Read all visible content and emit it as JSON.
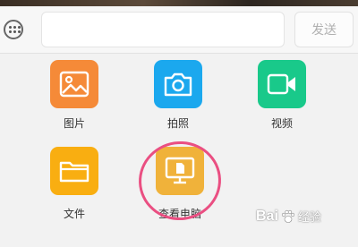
{
  "composer": {
    "input_value": "",
    "send_label": "发送"
  },
  "attachments": [
    {
      "label": "图片",
      "icon": "image-icon",
      "color": "#f58a38"
    },
    {
      "label": "拍照",
      "icon": "camera-icon",
      "color": "#1ba8ee"
    },
    {
      "label": "视频",
      "icon": "video-icon",
      "color": "#19c98a"
    },
    {
      "label": "文件",
      "icon": "folder-icon",
      "color": "#f9ae11"
    },
    {
      "label": "查看电脑",
      "icon": "computer-file-icon",
      "color": "#f0b23a"
    }
  ],
  "highlight_color": "#ea4f82",
  "watermark": {
    "brand": "Bai",
    "suffix": "经验"
  }
}
